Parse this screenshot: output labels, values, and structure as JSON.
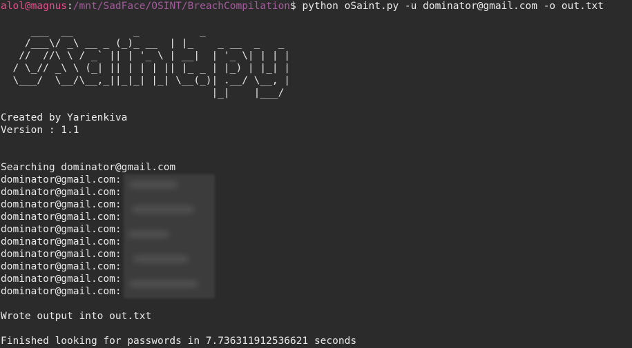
{
  "prompt": {
    "user_host": "alol@magnus",
    "separator": ":",
    "path": "/mnt/SadFace/OSINT/BreachCompilation",
    "dollar": "$ ",
    "command": "python oSaint.py -u dominator@gmail.com -o out.txt"
  },
  "banner": [
    "     ___  __          _          _",
    "    /___\\/ _\\ __ _ (_)_ __  | |_    _ __  _   _",
    "   //  //\\ \\ / _` || | '_ \\ | __|  | '_ \\| | | |",
    "  / \\_// _\\ \\ (_| || | | | || |_ _ | |_) | |_| |",
    "  \\___/  \\__/\\__,_||_|_| |_| \\__(_)| .__/ \\__, |",
    "                                   |_|    |___/"
  ],
  "info": {
    "created_by": "Created by Yarienkiva",
    "version": "Version : 1.1"
  },
  "search": {
    "searching_line": "Searching dominator@gmail.com",
    "results": [
      "dominator@gmail.com:",
      "dominator@gmail.com:",
      "dominator@gmail.com:",
      "dominator@gmail.com:",
      "dominator@gmail.com:",
      "dominator@gmail.com:",
      "dominator@gmail.com:",
      "dominator@gmail.com:",
      "dominator@gmail.com:",
      "dominator@gmail.com:"
    ]
  },
  "output": {
    "wrote": "Wrote output into out.txt",
    "finished": "Finished looking for passwords in 7.736311912536621 seconds"
  },
  "colors": {
    "background": "#2b2b2b",
    "text": "#e9e9e9",
    "user_host": "#e44c8a",
    "path": "#a45a9c"
  }
}
